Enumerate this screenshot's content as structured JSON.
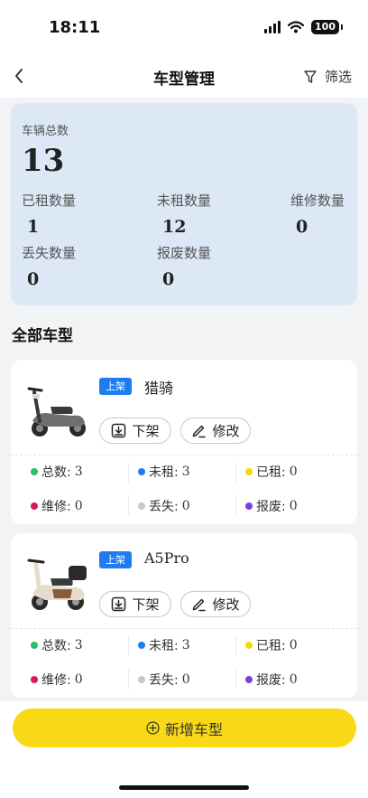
{
  "status_bar": {
    "time": "18:11",
    "battery": "100"
  },
  "nav": {
    "title": "车型管理",
    "filter_label": "筛选"
  },
  "summary": {
    "total_label": "车辆总数",
    "total_value": "13",
    "stats": [
      {
        "label": "已租数量",
        "value": "1"
      },
      {
        "label": "未租数量",
        "value": "12"
      },
      {
        "label": "维修数量",
        "value": "0"
      },
      {
        "label": "丢失数量",
        "value": "0"
      },
      {
        "label": "报废数量",
        "value": "0"
      }
    ]
  },
  "section_title": "全部车型",
  "models": [
    {
      "badge": "上架",
      "name": "猎骑",
      "off_label": "下架",
      "edit_label": "修改",
      "stats": [
        {
          "label": "总数:",
          "value": "3",
          "color": "#2ebd6b"
        },
        {
          "label": "未租:",
          "value": "3",
          "color": "#1e7cf0"
        },
        {
          "label": "已租:",
          "value": "0",
          "color": "#f5d90a"
        },
        {
          "label": "维修:",
          "value": "0",
          "color": "#e0155f"
        },
        {
          "label": "丢失:",
          "value": "0",
          "color": "#c8c8c8"
        },
        {
          "label": "报废:",
          "value": "0",
          "color": "#7b3fe0"
        }
      ]
    },
    {
      "badge": "上架",
      "name": "A5Pro",
      "off_label": "下架",
      "edit_label": "修改",
      "stats": [
        {
          "label": "总数:",
          "value": "3",
          "color": "#2ebd6b"
        },
        {
          "label": "未租:",
          "value": "3",
          "color": "#1e7cf0"
        },
        {
          "label": "已租:",
          "value": "0",
          "color": "#f5d90a"
        },
        {
          "label": "维修:",
          "value": "0",
          "color": "#e0155f"
        },
        {
          "label": "丢失:",
          "value": "0",
          "color": "#c8c8c8"
        },
        {
          "label": "报废:",
          "value": "0",
          "color": "#7b3fe0"
        }
      ]
    }
  ],
  "add_button_label": "新增车型",
  "colors": {
    "accent_yellow": "#f9d916",
    "summary_bg": "#dde8f6",
    "badge_blue": "#1e7cf0"
  },
  "icons": [
    "chevron-left-icon",
    "filter-icon",
    "download-icon",
    "edit-icon",
    "plus-circle-icon"
  ]
}
